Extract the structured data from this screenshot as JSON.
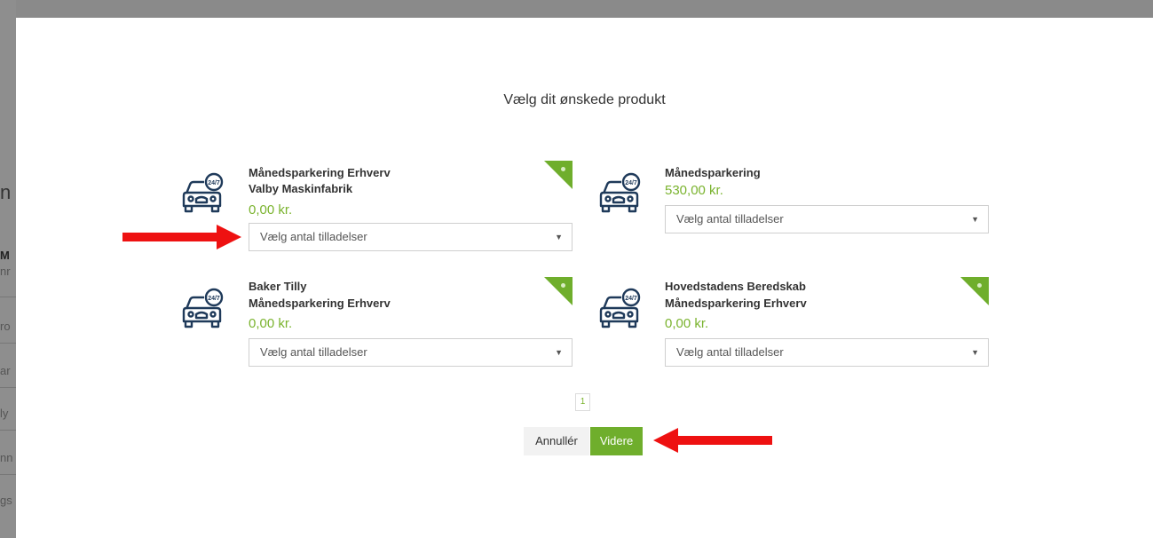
{
  "background": {
    "fragments": [
      "n",
      "M",
      "nr",
      "ro",
      "ar",
      "ly",
      "nn",
      "gs"
    ]
  },
  "modal": {
    "title": "Vælg dit ønskede produkt",
    "products": [
      {
        "name_line1": "Månedsparkering Erhverv",
        "name_line2": "Valby Maskinfabrik",
        "price": "0,00 kr.",
        "select_placeholder": "Vælg antal tilladelser",
        "badge": true
      },
      {
        "name_line1": "Månedsparkering",
        "name_line2": "",
        "price": "530,00 kr.",
        "select_placeholder": "Vælg antal tilladelser",
        "badge": false
      },
      {
        "name_line1": "Baker Tilly",
        "name_line2": "Månedsparkering Erhverv",
        "price": "0,00 kr.",
        "select_placeholder": "Vælg antal tilladelser",
        "badge": true
      },
      {
        "name_line1": "Hovedstadens Beredskab",
        "name_line2": "Månedsparkering Erhverv",
        "price": "0,00 kr.",
        "select_placeholder": "Vælg antal tilladelser",
        "badge": true
      }
    ],
    "pagination": {
      "current_page": "1"
    },
    "buttons": {
      "cancel": "Annullér",
      "next": "Videre"
    }
  },
  "colors": {
    "accent": "#6fae2c",
    "price": "#7ab32e",
    "annotation_arrow": "#ee1111"
  },
  "icons": [
    "car-24-7-icon",
    "lock-icon",
    "chevron-down-icon",
    "arrow-annotation"
  ]
}
